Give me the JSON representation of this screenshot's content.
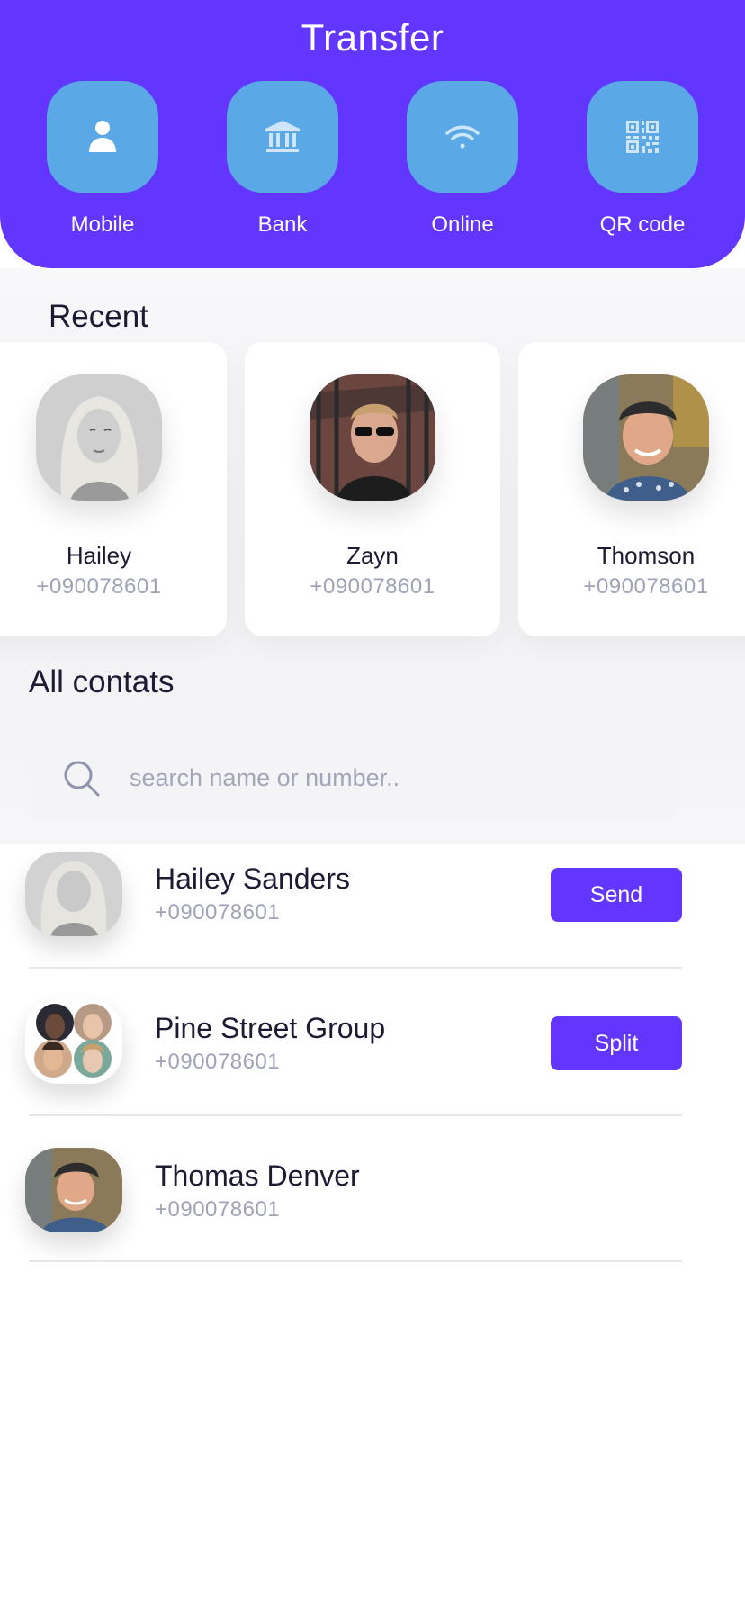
{
  "header": {
    "title": "Transfer",
    "background": "#6236ff",
    "methods": [
      {
        "label": "Mobile",
        "icon": "person-icon"
      },
      {
        "label": "Bank",
        "icon": "bank-icon"
      },
      {
        "label": "Online",
        "icon": "wifi-icon"
      },
      {
        "label": "QR code",
        "icon": "qr-code-icon"
      }
    ]
  },
  "recent": {
    "title": "Recent",
    "contacts": [
      {
        "name": "Hailey",
        "phone": "+090078601"
      },
      {
        "name": "Zayn",
        "phone": "+090078601"
      },
      {
        "name": "Thomson",
        "phone": "+090078601"
      }
    ]
  },
  "all_contacts": {
    "title": "All contats",
    "search": {
      "placeholder": "search name or number..",
      "value": ""
    },
    "contacts": [
      {
        "name": "Hailey Sanders",
        "phone": "+090078601",
        "action": "Send"
      },
      {
        "name": "Pine Street Group",
        "phone": "+090078601",
        "action": "Split"
      },
      {
        "name": "Thomas Denver",
        "phone": "+090078601"
      }
    ]
  },
  "colors": {
    "accent": "#6236ff",
    "tile": "#5aa8e5",
    "muted_text": "#a0a3b8"
  }
}
